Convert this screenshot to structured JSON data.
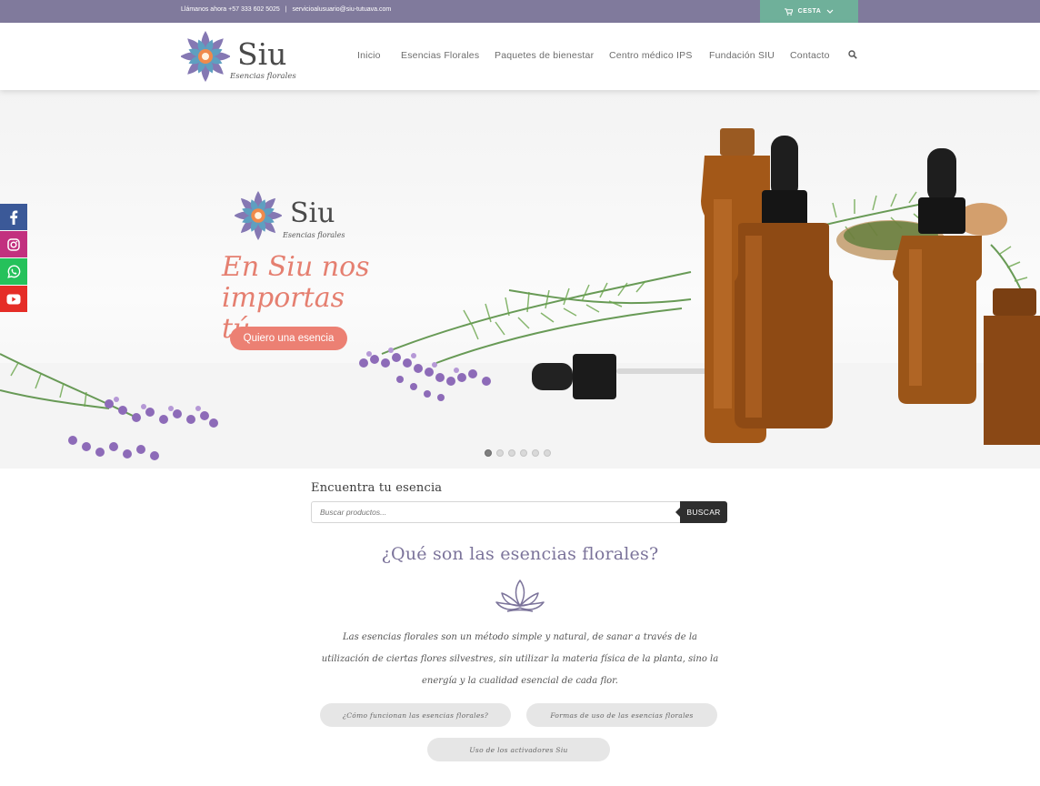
{
  "topbar": {
    "phone": "Llámanos ahora +57 333 602 5025",
    "separator": "|",
    "email": "servicioalusuario@siu-tutuava.com",
    "cart_label": "CESTA"
  },
  "brand": {
    "name": "Siu",
    "tagline": "Esencias florales"
  },
  "nav": {
    "items": [
      "Inicio",
      "Esencias Florales",
      "Paquetes de bienestar",
      "Centro médico IPS",
      "Fundación SIU",
      "Contacto"
    ]
  },
  "hero": {
    "title": "En Siu nos importas tú",
    "button": "Quiero una esencia",
    "slides_total": 6,
    "active_slide": 1
  },
  "social": [
    "facebook-icon",
    "instagram-icon",
    "whatsapp-icon",
    "youtube-icon"
  ],
  "search": {
    "title": "Encuentra tu esencia",
    "placeholder": "Buscar productos...",
    "button": "BUSCAR"
  },
  "about": {
    "title": "¿Qué son las esencias florales?",
    "description": "Las esencias florales son un método simple y natural, de sanar a través de la utilización de ciertas flores silvestres, sin utilizar la materia física de la planta, sino la energía y la cualidad esencial de cada flor.",
    "buttons": [
      "¿Cómo funcionan las esencias florales?",
      "Formas de uso de las esencias florales",
      "Uso de los activadores Siu"
    ]
  },
  "colors": {
    "topbar": "#807a9c",
    "cart": "#6fb09a",
    "accent": "#ec8073",
    "heading": "#7b739a"
  }
}
